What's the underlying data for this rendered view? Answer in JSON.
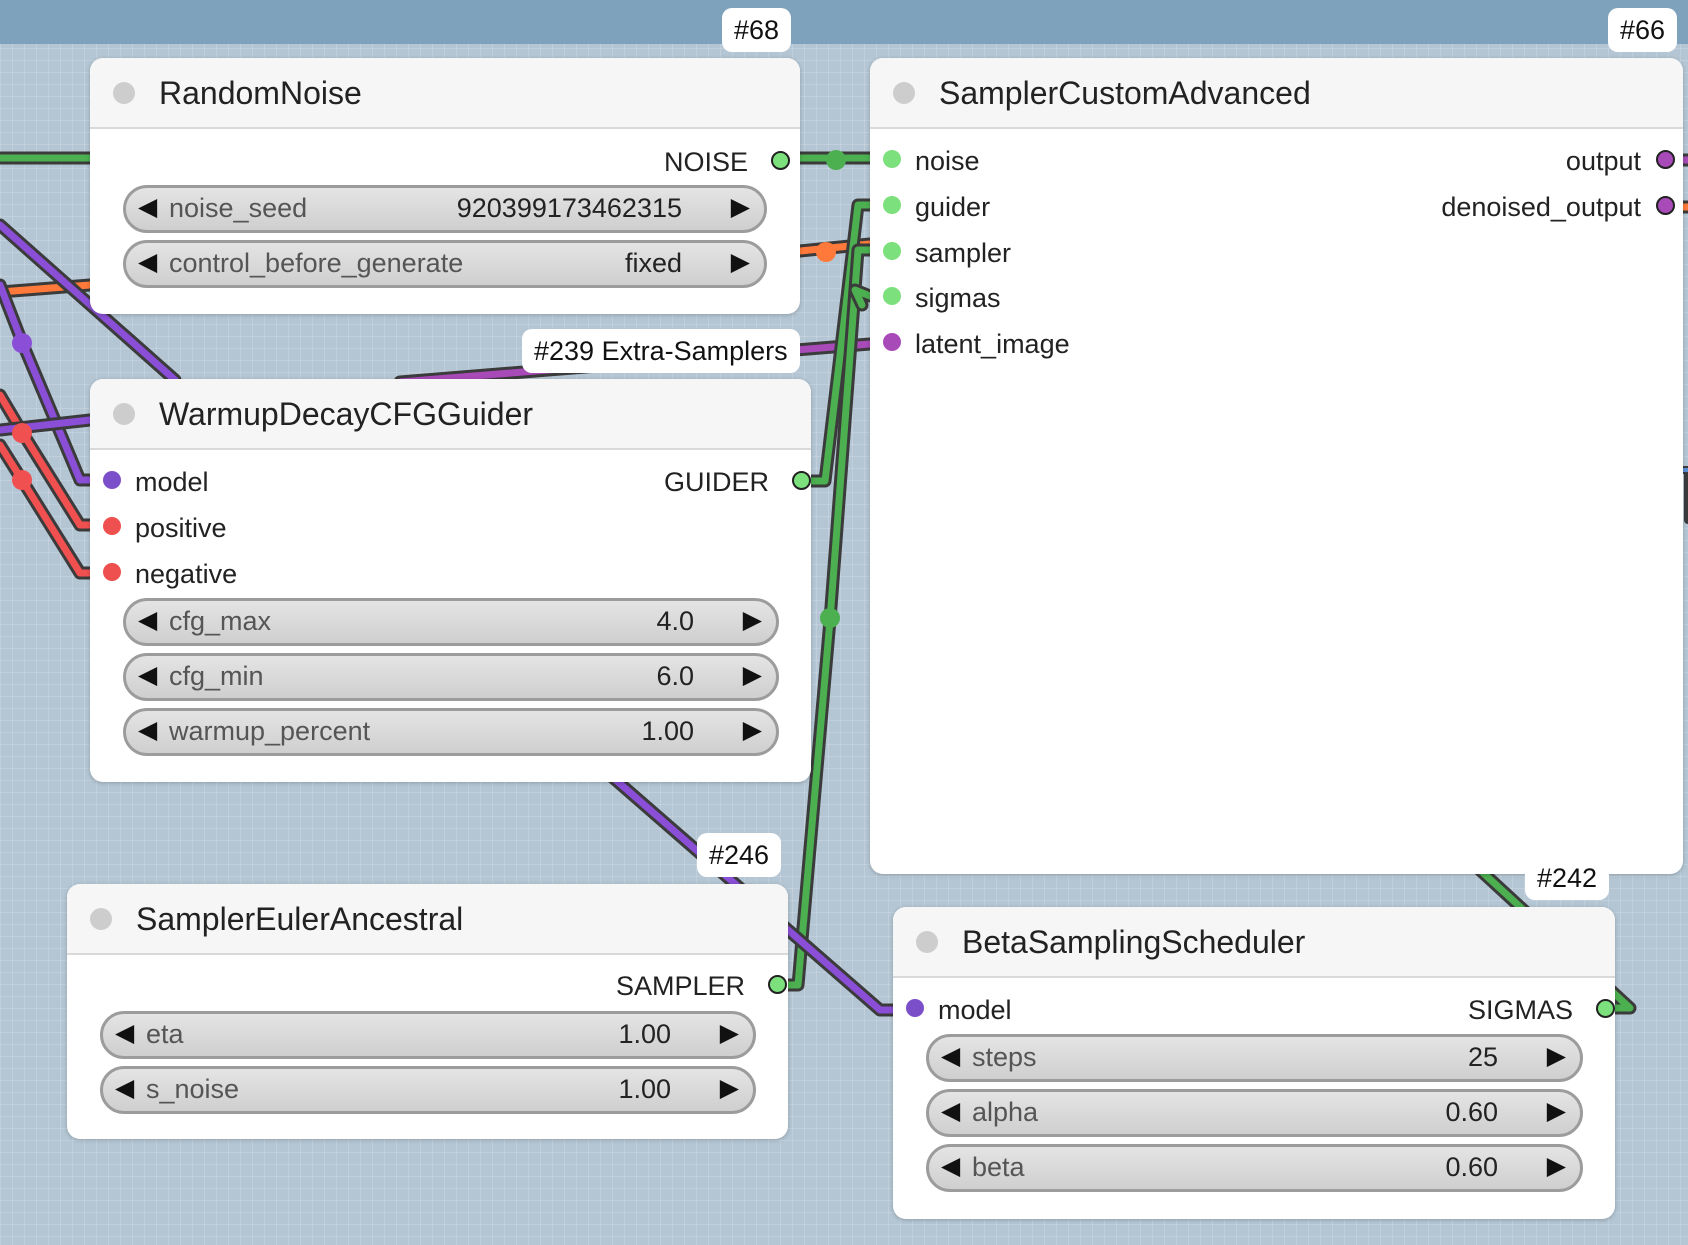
{
  "colors": {
    "model_slot": "#7b4fc9",
    "conditioning_slot": "#ee4f4f",
    "generic_slot": "#7ce07c",
    "latent_slot": "#a84ab8",
    "wire_green": "#4caf50",
    "wire_purple": "#8a4fd6",
    "wire_red": "#f05050",
    "wire_orange": "#ff7a3a",
    "canvas": "#b4c6d4"
  },
  "nodes": {
    "random_noise": {
      "badge": "#68",
      "title": "RandomNoise",
      "outputs": [
        "NOISE"
      ],
      "widgets": [
        {
          "name": "noise_seed",
          "value": "920399173462315"
        },
        {
          "name": "control_before_generate",
          "value": "fixed"
        }
      ]
    },
    "warmup_guider": {
      "badge": "#239 Extra-Samplers",
      "title": "WarmupDecayCFGGuider",
      "inputs": [
        "model",
        "positive",
        "negative"
      ],
      "outputs": [
        "GUIDER"
      ],
      "widgets": [
        {
          "name": "cfg_max",
          "value": "4.0"
        },
        {
          "name": "cfg_min",
          "value": "6.0"
        },
        {
          "name": "warmup_percent",
          "value": "1.00"
        }
      ]
    },
    "sampler_custom_advanced": {
      "badge": "#66",
      "title": "SamplerCustomAdvanced",
      "inputs": [
        "noise",
        "guider",
        "sampler",
        "sigmas",
        "latent_image"
      ],
      "outputs": [
        "output",
        "denoised_output"
      ]
    },
    "sampler_euler_ancestral": {
      "badge": "#246",
      "title": "SamplerEulerAncestral",
      "outputs": [
        "SAMPLER"
      ],
      "widgets": [
        {
          "name": "eta",
          "value": "1.00"
        },
        {
          "name": "s_noise",
          "value": "1.00"
        }
      ]
    },
    "beta_scheduler": {
      "badge": "#242",
      "title": "BetaSamplingScheduler",
      "inputs": [
        "model"
      ],
      "outputs": [
        "SIGMAS"
      ],
      "widgets": [
        {
          "name": "steps",
          "value": "25"
        },
        {
          "name": "alpha",
          "value": "0.60"
        },
        {
          "name": "beta",
          "value": "0.60"
        }
      ]
    }
  },
  "arrows": {
    "left": "◀",
    "right": "▶"
  }
}
